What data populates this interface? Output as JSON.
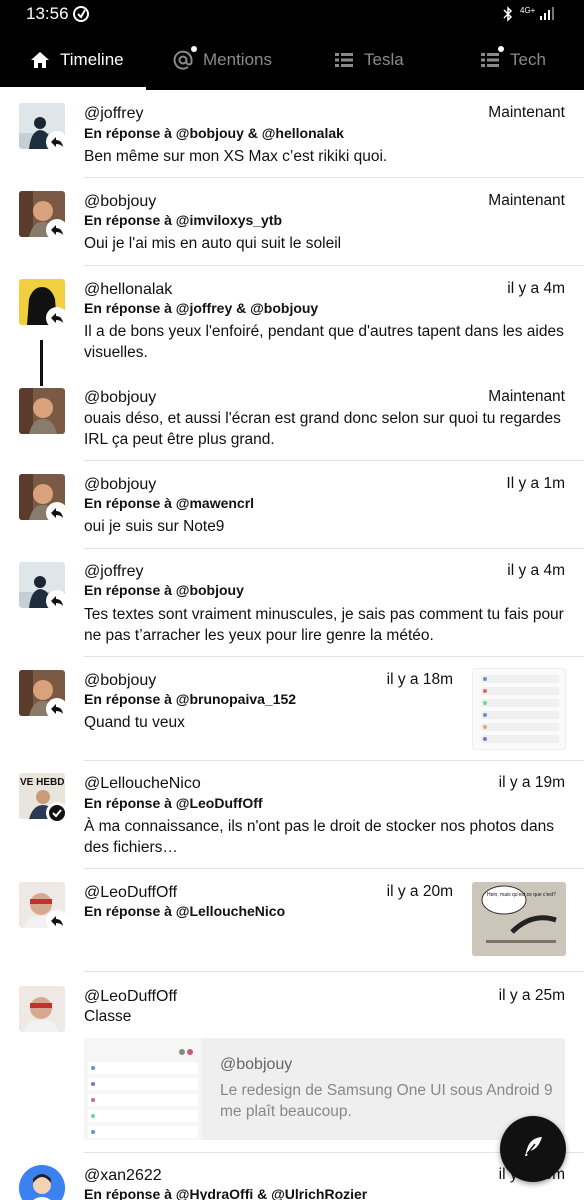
{
  "status_bar": {
    "time": "13:56",
    "network": "4G+"
  },
  "tabs": [
    {
      "label": "Timeline",
      "icon": "home-icon",
      "active": true
    },
    {
      "label": "Mentions",
      "icon": "at-icon",
      "active": false
    },
    {
      "label": "Tesla",
      "icon": "list-icon",
      "active": false
    },
    {
      "label": "Tech",
      "icon": "list-icon",
      "active": false
    }
  ],
  "tweets": [
    {
      "handle": "@joffrey",
      "reply_to": "En réponse à @bobjouy & @hellonalak",
      "text": "Ben même sur mon XS Max c’est rikiki quoi.",
      "time": "Maintenant"
    },
    {
      "handle": "@bobjouy",
      "reply_to": "En réponse à @imviloxys_ytb",
      "text": "Oui je l'ai mis en auto qui suit le soleil",
      "time": "Maintenant"
    },
    {
      "handle": "@hellonalak",
      "reply_to": "En réponse à @joffrey & @bobjouy",
      "text": "Il a de bons yeux l'enfoiré, pendant que d'autres tapent dans les aides visuelles.",
      "time": "il y a 4m"
    },
    {
      "handle": "@bobjouy",
      "reply_to": "",
      "text": "ouais déso, et aussi l'écran est grand donc selon sur quoi tu regardes IRL ça peut être plus grand.",
      "time": "Maintenant"
    },
    {
      "handle": "@bobjouy",
      "reply_to": "En réponse à @mawencrl",
      "text": "oui je suis sur Note9",
      "time": "Il y a 1m"
    },
    {
      "handle": "@joffrey",
      "reply_to": "En réponse à @bobjouy",
      "text": "Tes textes sont vraiment minuscules, je sais pas comment tu fais pour ne pas t’arracher les yeux pour lire genre la météo.",
      "time": "il y a 4m"
    },
    {
      "handle": "@bobjouy",
      "reply_to": "En réponse à @brunopaiva_152",
      "text": "Quand tu veux",
      "time": "il y a 18m"
    },
    {
      "handle": "@LelloucheNico",
      "reply_to": "En réponse à @LeoDuffOff",
      "text": "À ma connaissance, ils n'ont pas le droit de stocker nos photos dans des fichiers…",
      "time": "il y a 19m"
    },
    {
      "handle": "@LeoDuffOff",
      "reply_to": "En réponse à @LelloucheNico",
      "text": "",
      "time": "il y a 20m"
    },
    {
      "handle": "@LeoDuffOff",
      "reply_to": "",
      "text": "Classe",
      "time": "il y a 25m"
    },
    {
      "handle": "@xan2622",
      "reply_to": "En réponse à @HydraOffi & @UlrichRozier",
      "text": "",
      "time": "il y a 26m"
    }
  ],
  "quote": {
    "handle": "@bobjouy",
    "text": "Le redesign de Samsung One UI sous Android 9 me plaît beaucoup."
  },
  "avatar_text": {
    "lellouche": "VE HEBD"
  },
  "thumb_comic_text": "Hein, mais qu'est ce que c'est?",
  "colors": {
    "bar": "#000000",
    "accent": "#ffffff",
    "separator": "#e3e3e3",
    "quote_bg": "#efefef"
  }
}
